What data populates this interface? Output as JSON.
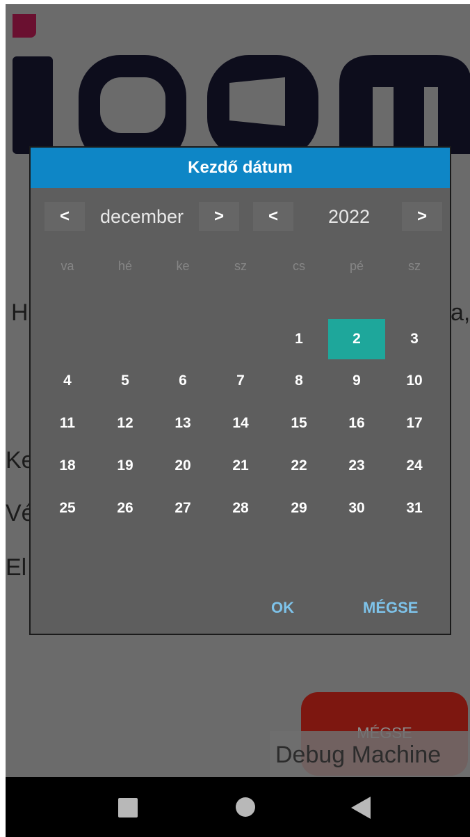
{
  "dialog": {
    "title": "Kezdő dátum",
    "month_nav": {
      "prev": "<",
      "next": ">",
      "value": "december"
    },
    "year_nav": {
      "prev": "<",
      "next": ">",
      "value": "2022"
    },
    "weekdays": [
      "va",
      "hé",
      "ke",
      "sz",
      "cs",
      "pé",
      "sz"
    ],
    "weeks": [
      [
        "",
        "",
        "",
        "",
        "1",
        "2",
        "3"
      ],
      [
        "4",
        "5",
        "6",
        "7",
        "8",
        "9",
        "10"
      ],
      [
        "11",
        "12",
        "13",
        "14",
        "15",
        "16",
        "17"
      ],
      [
        "18",
        "19",
        "20",
        "21",
        "22",
        "23",
        "24"
      ],
      [
        "25",
        "26",
        "27",
        "28",
        "29",
        "30",
        "31"
      ]
    ],
    "selected_day": "2",
    "ok_label": "OK",
    "cancel_label": "MÉGSE"
  },
  "background": {
    "partial_labels": [
      "H",
      "a,",
      "Ke",
      "Vé",
      "El"
    ],
    "cancel_button_label": "MÉGSE"
  },
  "debug_banner": "Debug Machine",
  "colors": {
    "title_bar": "#0e86c6",
    "selected_day": "#1ea79b",
    "action_text": "#7ec3ea",
    "brand": "#6a1030"
  },
  "system_nav": {
    "buttons": [
      "recents-icon",
      "home-icon",
      "back-icon"
    ]
  }
}
